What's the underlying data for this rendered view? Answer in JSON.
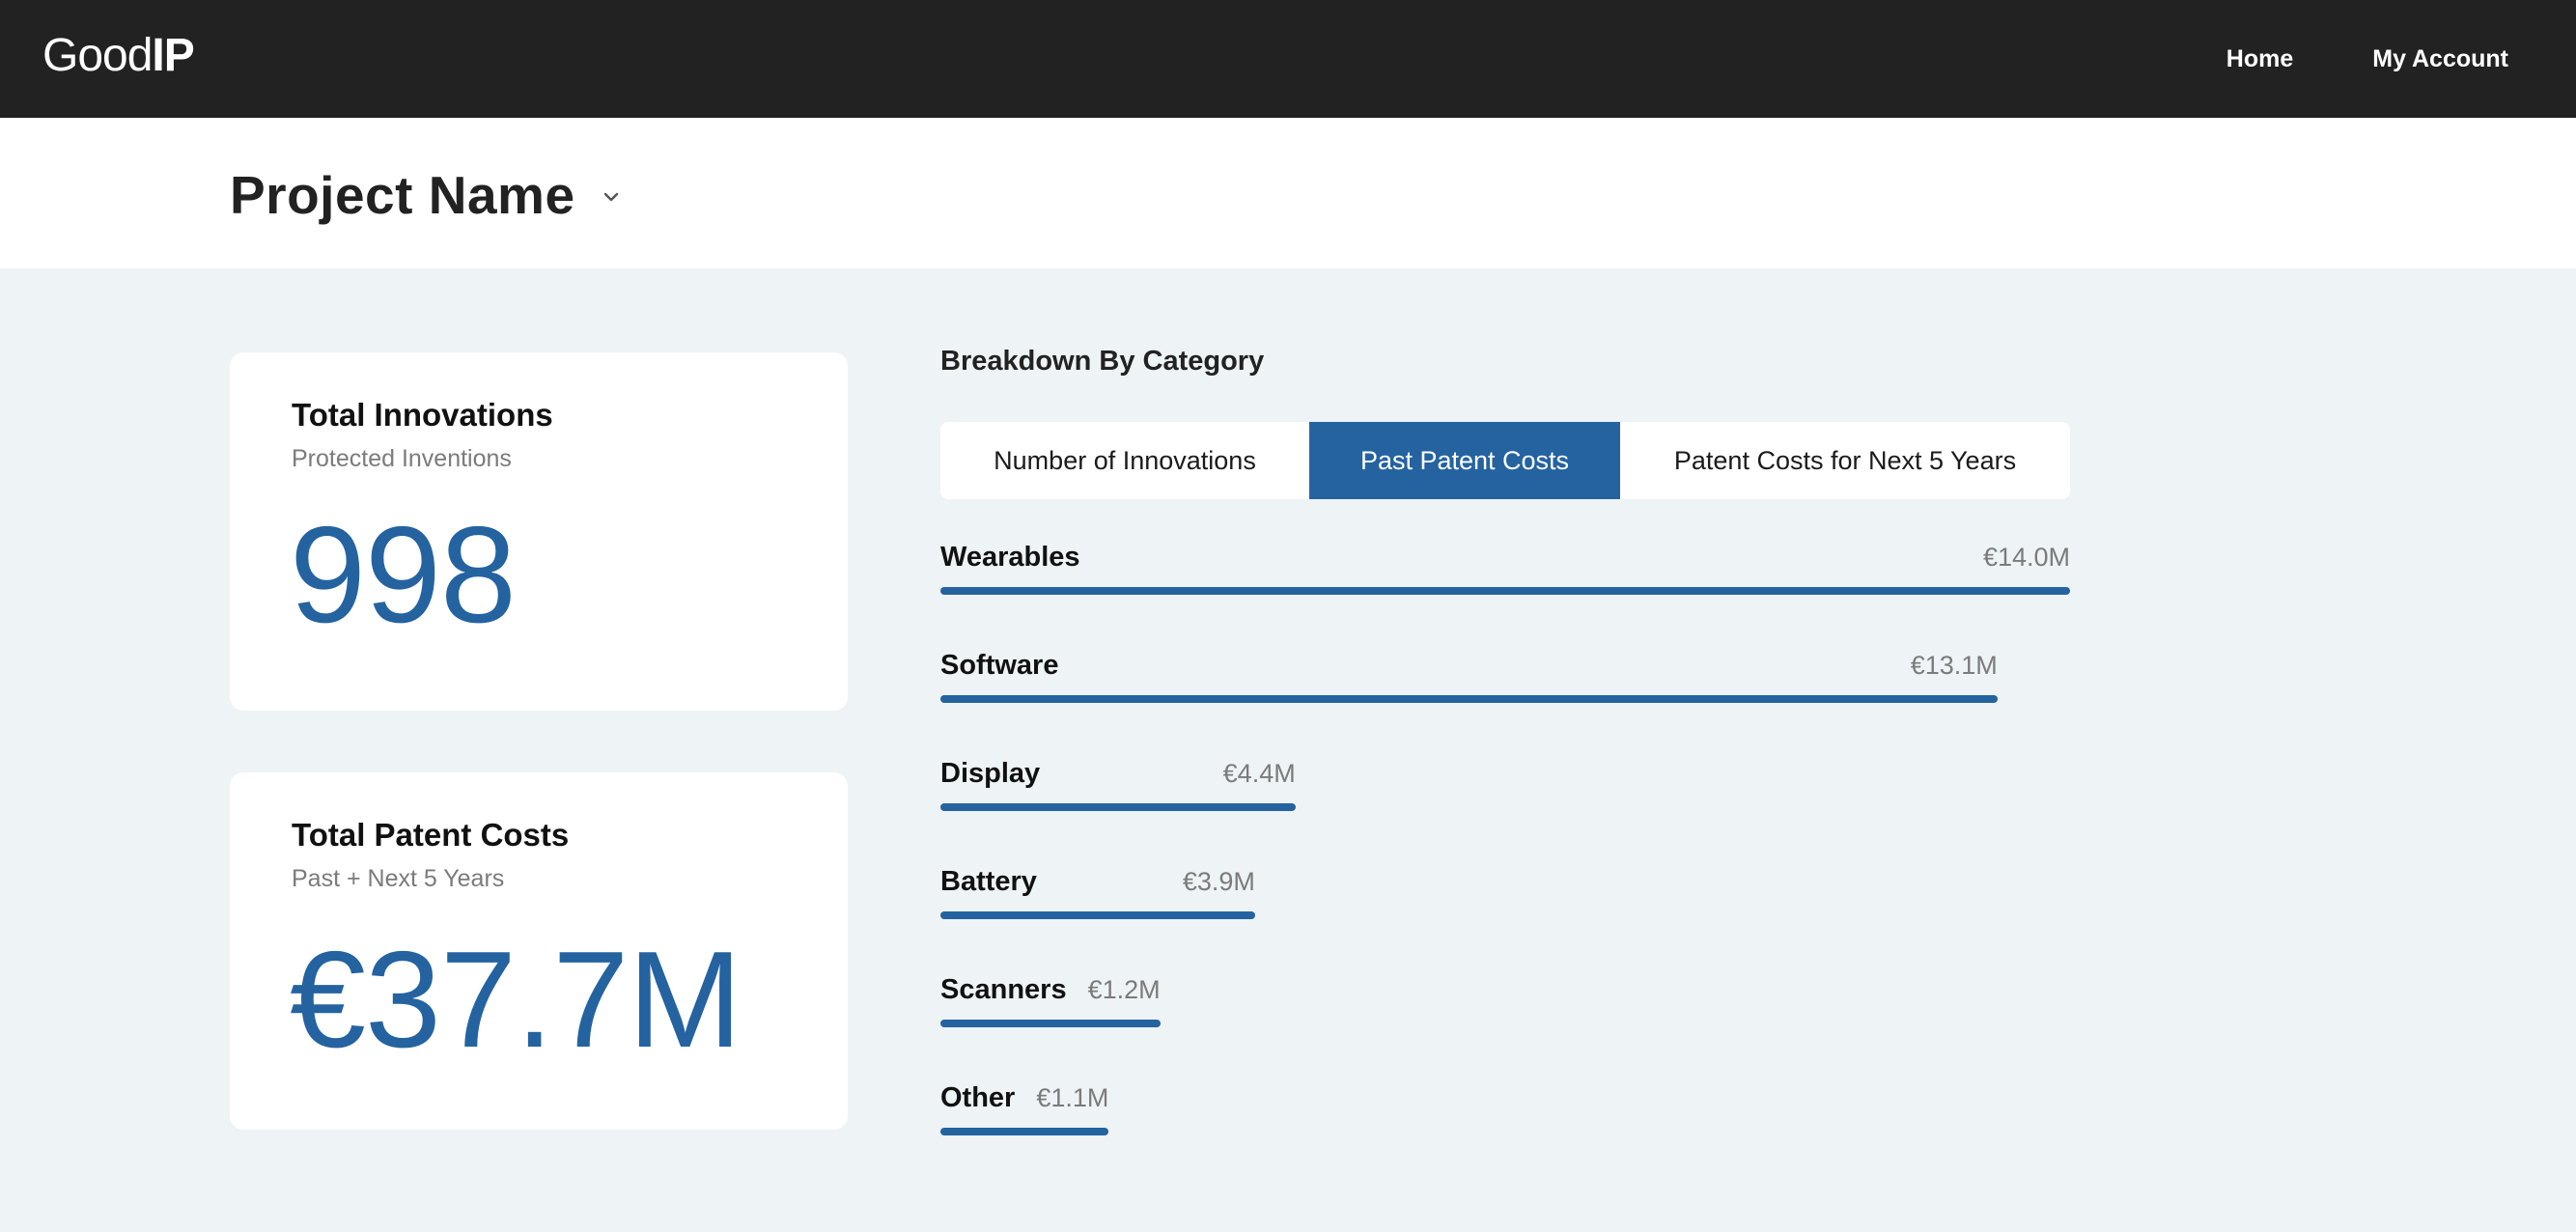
{
  "header": {
    "logo_light": "Good",
    "logo_bold": "IP",
    "nav": [
      {
        "label": "Home"
      },
      {
        "label": "My Account"
      }
    ]
  },
  "project": {
    "title": "Project Name",
    "dropdown_icon": "chevron-down-icon"
  },
  "cards": [
    {
      "title": "Total Innovations",
      "subtitle": "Protected Inventions",
      "value": "998"
    },
    {
      "title": "Total Patent Costs",
      "subtitle": "Past + Next 5 Years",
      "value": "€37.7M"
    }
  ],
  "breakdown": {
    "title": "Breakdown By Category",
    "tabs": [
      {
        "label": "Number of Innovations",
        "active": false
      },
      {
        "label": "Past Patent Costs",
        "active": true
      },
      {
        "label": "Patent Costs for Next 5 Years",
        "active": false
      }
    ],
    "accent_color": "#2463a0",
    "rows": [
      {
        "label": "Wearables",
        "value_text": "€14.0M",
        "value": 14.0
      },
      {
        "label": "Software",
        "value_text": "€13.1M",
        "value": 13.1
      },
      {
        "label": "Display",
        "value_text": "€4.4M",
        "value": 4.4
      },
      {
        "label": "Battery",
        "value_text": "€3.9M",
        "value": 3.9
      },
      {
        "label": "Scanners",
        "value_text": "€1.2M",
        "value": 1.2
      },
      {
        "label": "Other",
        "value_text": "€1.1M",
        "value": 1.1
      }
    ]
  }
}
